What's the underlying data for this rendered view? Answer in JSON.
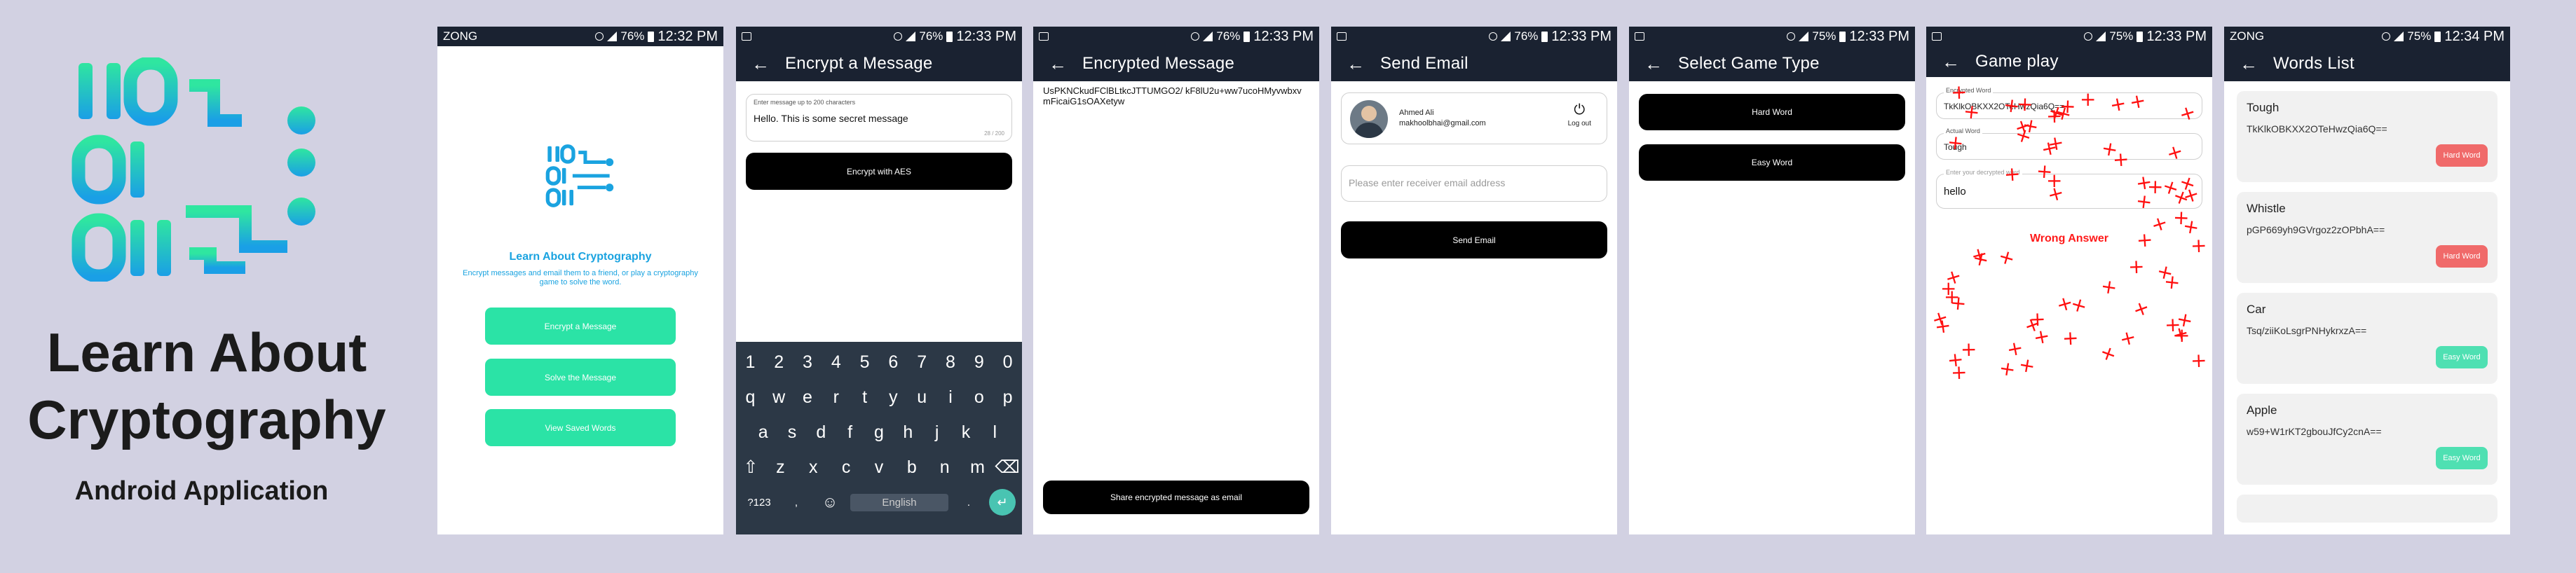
{
  "hero": {
    "title_line1": "Learn About",
    "title_line2": "Cryptography",
    "subtitle": "Android Application"
  },
  "colors": {
    "brand_green": "#2be3a6",
    "brand_blue": "#1aa3e0",
    "appbar": "#1a2231",
    "keyboard": "#2c3846",
    "hard_badge": "#f06a6a",
    "easy_badge": "#4fe0b2",
    "wrong": "#ff1a1a"
  },
  "status": {
    "carrier": "ZONG",
    "s1": {
      "battery": "76%",
      "time": "12:32 PM"
    },
    "s2": {
      "battery": "76%",
      "time": "12:33 PM"
    },
    "s3": {
      "battery": "76%",
      "time": "12:33 PM"
    },
    "s4": {
      "battery": "76%",
      "time": "12:33 PM"
    },
    "s5": {
      "battery": "75%",
      "time": "12:33 PM"
    },
    "s6": {
      "battery": "75%",
      "time": "12:33 PM"
    },
    "s7": {
      "battery": "75%",
      "time": "12:34 PM"
    }
  },
  "home": {
    "title": "Learn About Cryptography",
    "desc": "Encrypt messages and email them to a friend, or play a cryptography game to solve the word.",
    "btn_encrypt": "Encrypt a Message",
    "btn_solve": "Solve the Message",
    "btn_saved": "View Saved Words"
  },
  "encrypt": {
    "title": "Encrypt a Message",
    "label": "Enter message up to 200 characters",
    "value": "Hello. This is some secret message",
    "counter": "28 / 200",
    "button": "Encrypt with AES"
  },
  "keyboard": {
    "numbers": [
      "1",
      "2",
      "3",
      "4",
      "5",
      "6",
      "7",
      "8",
      "9",
      "0"
    ],
    "row1": [
      "q",
      "w",
      "e",
      "r",
      "t",
      "y",
      "u",
      "i",
      "o",
      "p"
    ],
    "row2": [
      "a",
      "s",
      "d",
      "f",
      "g",
      "h",
      "j",
      "k",
      "l"
    ],
    "row3": [
      "z",
      "x",
      "c",
      "v",
      "b",
      "n",
      "m"
    ],
    "sym": "?123",
    "comma": ",",
    "lang": "English"
  },
  "encrypted": {
    "title": "Encrypted Message",
    "text": "UsPKNCkudFClBLtkcJTTUMGO2/ kF8lU2u+ww7ucoHMyvwbxvmFicaiG1sOAXetyw",
    "button": "Share encrypted message as email"
  },
  "email": {
    "title": "Send Email",
    "name": "Ahmed Ali",
    "email": "makhoolbhai@gmail.com",
    "logout": "Log out",
    "placeholder": "Please enter receiver email address",
    "button": "Send Email"
  },
  "select": {
    "title": "Select Game Type",
    "hard": "Hard Word",
    "easy": "Easy Word"
  },
  "game": {
    "title": "Game play",
    "enc_label": "Encrypted Word",
    "enc_value": "TkKlkOBKXX2OTeHwzQia6Q==",
    "actual_label": "Actual Word",
    "actual_value": "Tough",
    "input_placeholder": "Enter your decrypted word",
    "input_value": "hello",
    "result": "Wrong Answer"
  },
  "words": {
    "title": "Words List",
    "items": [
      {
        "word": "Tough",
        "enc": "TkKlkOBKXX2OTeHwzQia6Q==",
        "badge": "Hard Word"
      },
      {
        "word": "Whistle",
        "enc": "pGP669yh9GVrgoz2zOPbhA==",
        "badge": "Hard Word"
      },
      {
        "word": "Car",
        "enc": "Tsq/ziiKoLsgrPNHykrxzA==",
        "badge": "Easy Word"
      },
      {
        "word": "Apple",
        "enc": "w59+W1rKT2gbouJfCy2cnA==",
        "badge": "Easy Word"
      }
    ]
  }
}
